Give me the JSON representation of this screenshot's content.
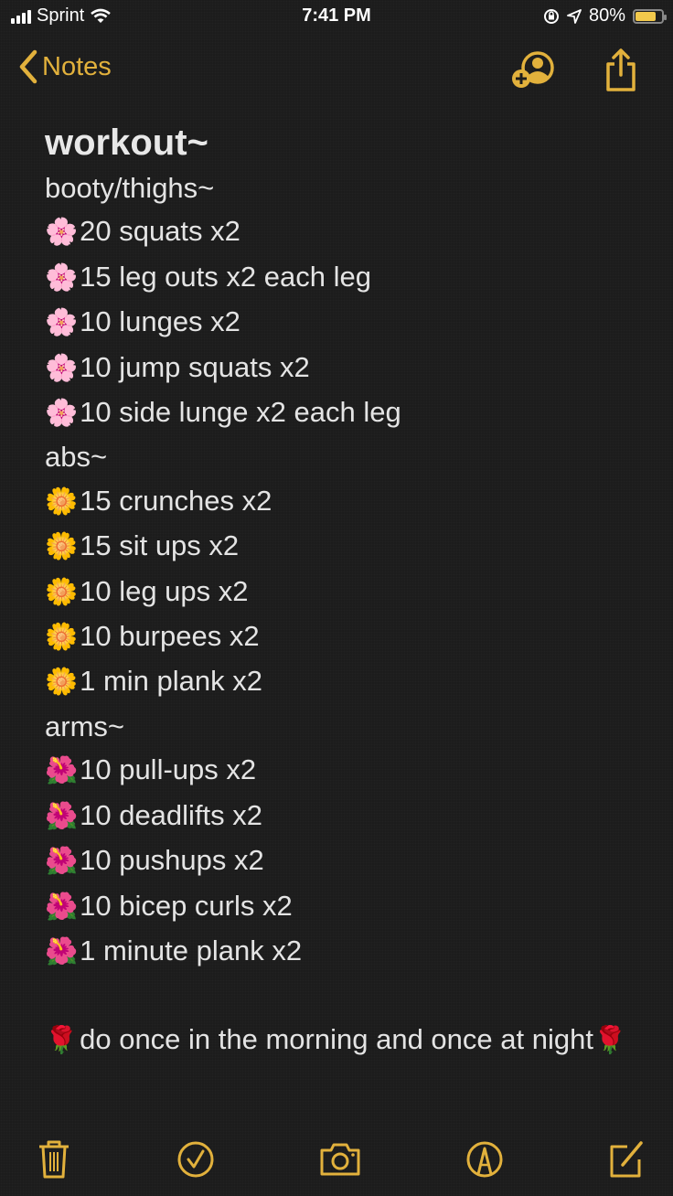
{
  "status_bar": {
    "carrier": "Sprint",
    "time": "7:41 PM",
    "battery_percent": "80%",
    "battery_level": 0.8,
    "icons": [
      "signal-icon",
      "wifi-icon",
      "orientation-lock-icon",
      "location-icon",
      "battery-icon"
    ]
  },
  "nav": {
    "back_label": "Notes",
    "actions": [
      "add-collaborator",
      "share"
    ]
  },
  "note": {
    "title": "workout~",
    "sections": [
      {
        "heading": "booty/thighs~",
        "emoji": "🌸",
        "items": [
          "20 squats x2",
          "15 leg outs x2 each leg",
          "10 lunges x2",
          "10 jump squats x2",
          "10 side lunge x2 each leg"
        ]
      },
      {
        "heading": "abs~",
        "emoji": "🌼",
        "items": [
          "15 crunches x2",
          "15 sit ups x2",
          "10 leg ups x2",
          "10 burpees x2",
          "1 min plank x2"
        ]
      },
      {
        "heading": "arms~",
        "emoji": "🌺",
        "items": [
          "10 pull-ups x2",
          "10 deadlifts x2",
          "10 pushups x2",
          "10 bicep curls x2",
          "1 minute plank x2"
        ]
      }
    ],
    "footer": {
      "emoji": "🌹",
      "text": "do once in the morning and once at night"
    }
  },
  "toolbar": {
    "buttons": [
      "delete",
      "checklist",
      "camera",
      "markup",
      "compose"
    ]
  },
  "colors": {
    "accent": "#e2b13c",
    "background": "#1c1c1c",
    "text": "#e4e4e4"
  }
}
